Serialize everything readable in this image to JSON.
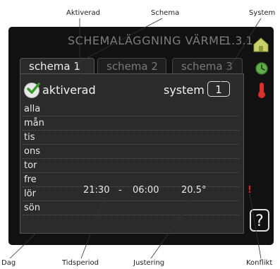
{
  "annotations": {
    "aktiverad": "Aktiverad",
    "schema": "Schema",
    "system": "System",
    "dag": "Dag",
    "tidsperiod": "Tidsperiod",
    "justering": "Justering",
    "konflikt": "Konflikt"
  },
  "screen": {
    "title": "SCHEMALÄGGNING VÄRME",
    "code": "1.3.1"
  },
  "tabs": [
    {
      "label": "schema 1",
      "active": true
    },
    {
      "label": "schema 2",
      "active": false
    },
    {
      "label": "schema 3",
      "active": false
    }
  ],
  "activated": {
    "label": "aktiverad",
    "checked": true
  },
  "system": {
    "label": "system",
    "value": "1"
  },
  "days": [
    {
      "day": "alla",
      "start": "",
      "sep": "",
      "end": "",
      "temp": ""
    },
    {
      "day": "mån",
      "start": "",
      "sep": "",
      "end": "",
      "temp": ""
    },
    {
      "day": "tis",
      "start": "",
      "sep": "",
      "end": "",
      "temp": ""
    },
    {
      "day": "ons",
      "start": "",
      "sep": "",
      "end": "",
      "temp": ""
    },
    {
      "day": "tor",
      "start": "",
      "sep": "",
      "end": "",
      "temp": ""
    },
    {
      "day": "fre",
      "start": "21:30",
      "sep": "-",
      "end": "06:00",
      "temp": "20.5°"
    },
    {
      "day": "lör",
      "start": "",
      "sep": "",
      "end": "",
      "temp": ""
    },
    {
      "day": "sön",
      "start": "",
      "sep": "",
      "end": "",
      "temp": ""
    }
  ],
  "conflict_marker": "!",
  "help": "?",
  "icons": {
    "house": "house-icon",
    "clock": "clock-icon",
    "thermometer": "thermometer-icon"
  },
  "colors": {
    "screen_bg": "#111111",
    "panel_bg": "#2b2b2b",
    "text": "#f2f2f2",
    "title_text": "#7c7c7c",
    "conflict": "#e02020",
    "house": "#c9d26a",
    "clock": "#5fae4a",
    "thermometer": "#d9302a"
  }
}
